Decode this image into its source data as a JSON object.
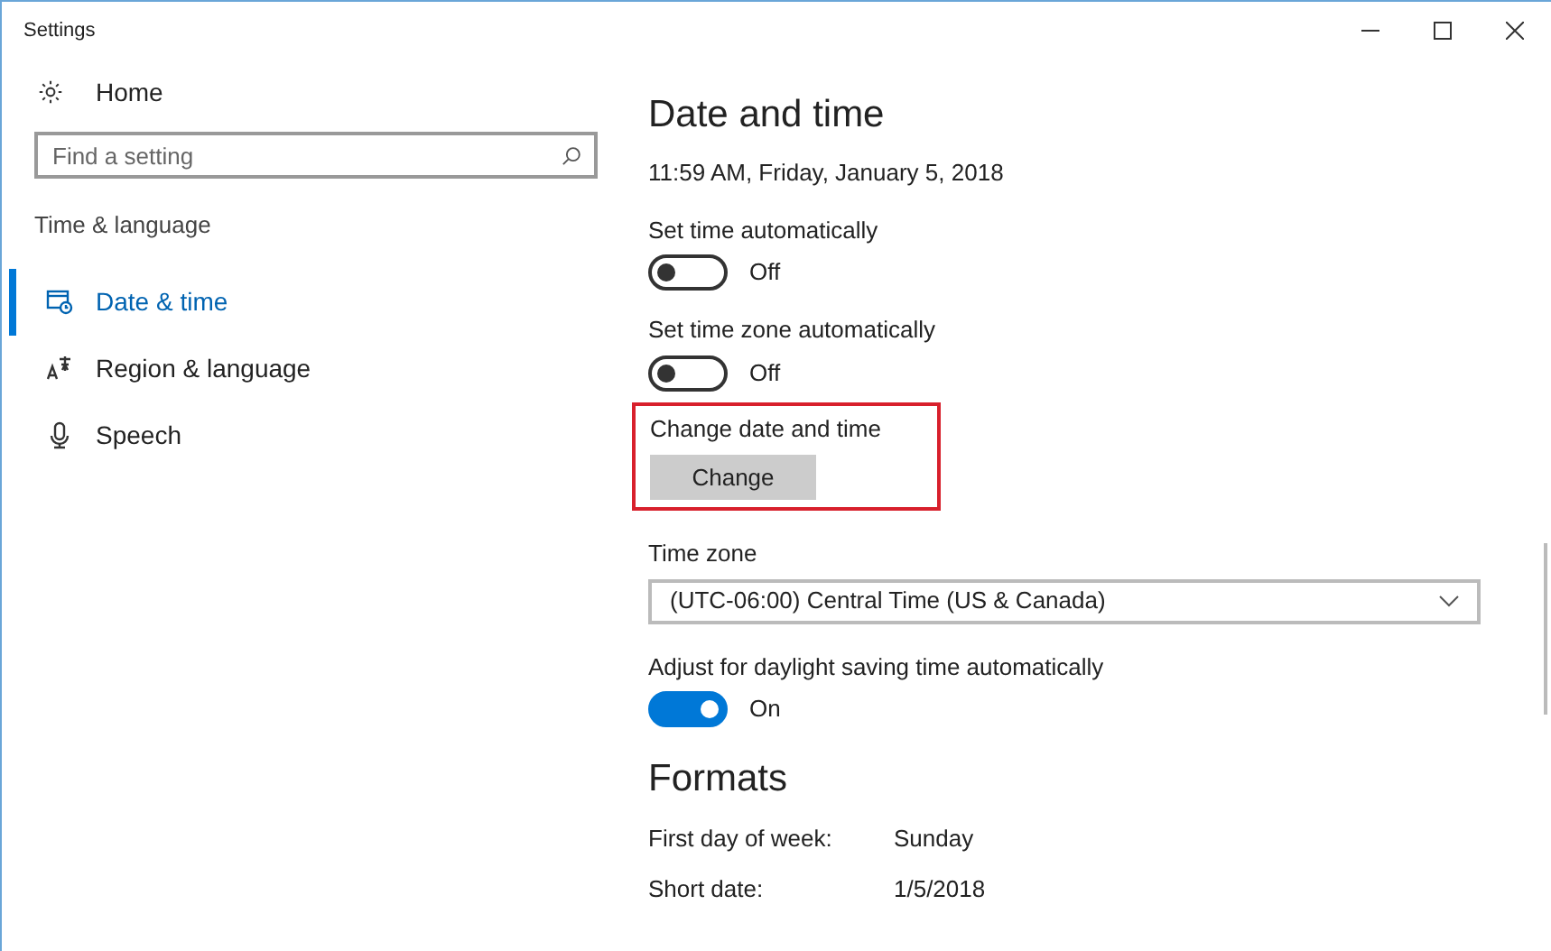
{
  "window": {
    "title": "Settings"
  },
  "sidebar": {
    "home": "Home",
    "search": {
      "placeholder": "Find a setting"
    },
    "category": "Time & language",
    "items": [
      {
        "label": "Date & time",
        "selected": true
      },
      {
        "label": "Region & language",
        "selected": false
      },
      {
        "label": "Speech",
        "selected": false
      }
    ]
  },
  "content": {
    "title": "Date and time",
    "current": "11:59 AM, Friday, January 5, 2018",
    "toggles": [
      {
        "label": "Set time automatically",
        "on": false,
        "state": "Off"
      },
      {
        "label": "Set time zone automatically",
        "on": false,
        "state": "Off"
      }
    ],
    "change": {
      "label": "Change date and time",
      "button": "Change",
      "highlighted": true
    },
    "time_zone": {
      "label": "Time zone",
      "value": "(UTC-06:00) Central Time (US & Canada)"
    },
    "daylight": {
      "label": "Adjust for daylight saving time automatically",
      "on": true,
      "state": "On"
    },
    "formats": {
      "title": "Formats",
      "rows": [
        {
          "label": "First day of week:",
          "value": "Sunday"
        },
        {
          "label": "Short date:",
          "value": "1/5/2018"
        }
      ]
    }
  }
}
